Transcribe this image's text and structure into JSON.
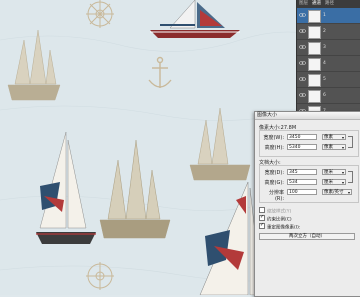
{
  "layers_panel": {
    "tabs": [
      "图层",
      "通道",
      "路径"
    ],
    "active_tab": 1,
    "rows": [
      {
        "name": "1"
      },
      {
        "name": "2"
      },
      {
        "name": "3"
      },
      {
        "name": "4"
      },
      {
        "name": "5"
      },
      {
        "name": "6"
      },
      {
        "name": "7"
      }
    ]
  },
  "dialog": {
    "title": "图像大小",
    "pixel_dimensions": "像素大小:27.8M",
    "width_label": "宽度(W):",
    "width_value": "3450",
    "width_unit": "像素",
    "height_label": "高度(H):",
    "height_value": "5340",
    "height_unit": "像素",
    "doc_size_label": "文档大小:",
    "doc_width_label": "宽度(D):",
    "doc_width_value": "345",
    "doc_width_unit": "厘米",
    "doc_height_label": "高度(G):",
    "doc_height_value": "534",
    "doc_height_unit": "厘米",
    "resolution_label": "分辨率(R):",
    "resolution_value": "100",
    "resolution_unit": "像素/英寸",
    "scale_styles": "缩放样式(Y)",
    "constrain": "约束比例(C)",
    "resample": "重定图像像素(I):",
    "method": "两次立方（自动）"
  },
  "colors": {
    "sea": "#dfe8ec",
    "panel": "#535353",
    "sail_red": "#b33a3a",
    "sail_blue": "#2f4f6f"
  }
}
